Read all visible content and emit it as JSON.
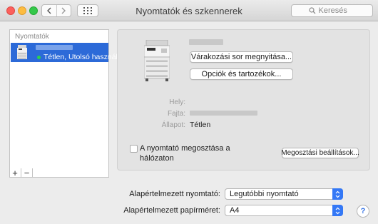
{
  "window": {
    "title": "Nyomtatók és szkennerek"
  },
  "toolbar": {
    "back_icon": "chevron-left-icon",
    "forward_icon": "chevron-right-icon",
    "grid_icon": "grid-icon",
    "search_placeholder": "Keresés"
  },
  "sidebar": {
    "header": "Nyomtatók",
    "printers": [
      {
        "name": "",
        "status": "Tétlen, Utolsó használat",
        "selected": true,
        "status_color": "#2ad34a"
      }
    ],
    "add_label": "+",
    "remove_label": "−"
  },
  "detail": {
    "printer_name": "",
    "open_queue_label": "Várakozási sor megnyitása...",
    "options_label": "Opciók és tartozékok...",
    "location_label": "Hely:",
    "location_value": "",
    "type_label": "Fajta:",
    "type_value": "",
    "status_label": "Állapot:",
    "status_value": "Tétlen",
    "share_label": "A nyomtató megosztása a hálózaton",
    "share_checked": false,
    "sharing_prefs_label": "Megosztási beállítások..."
  },
  "defaults": {
    "default_printer_label": "Alapértelmezett nyomtató:",
    "default_printer_value": "Legutóbbi nyomtató",
    "default_paper_label": "Alapértelmezett papírméret:",
    "default_paper_value": "A4"
  },
  "help_label": "?",
  "colors": {
    "accent": "#3478f6",
    "selection": "#2c6ad8"
  }
}
